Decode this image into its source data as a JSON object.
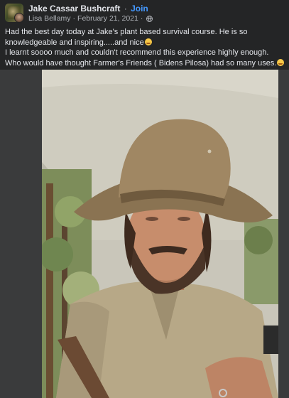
{
  "post": {
    "group_name": "Jake Cassar Bushcraft",
    "separator": "·",
    "join_label": "Join",
    "author": "Lisa Bellamy",
    "date": "February 21, 2021",
    "privacy_icon": "globe-icon",
    "text_lines": [
      "Had the best day today at Jake's plant based survival course. He is so knowledgeable and inspiring.....and nice",
      "I learnt soooo much and couldn't recommend this experience highly enough.",
      "Who would have thought Farmer's  Friends ( Bidens Pilosa) had so many uses."
    ],
    "emoji_icon": "smiling-face-emoji"
  },
  "colors": {
    "background": "#242526",
    "text_primary": "#e4e6eb",
    "text_secondary": "#b0b3b8",
    "link_blue": "#4599ff",
    "photo_letterbox": "#3a3b3c"
  }
}
